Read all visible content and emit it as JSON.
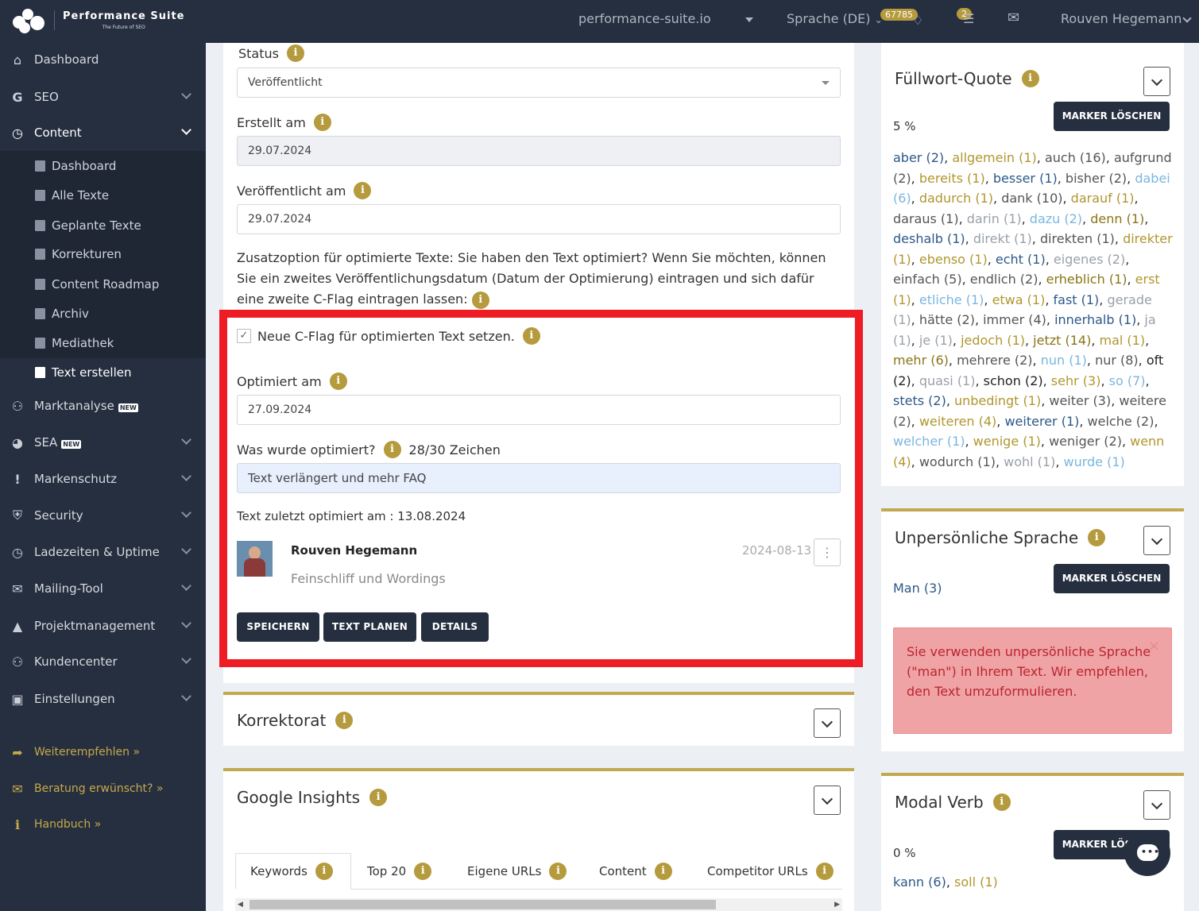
{
  "topbar": {
    "brand_title": "Performance Suite",
    "brand_sub": "The Future of SEO",
    "domain": "performance-suite.io",
    "language": "Sprache (DE)",
    "credits": "67785",
    "notifications": "2",
    "user": "Rouven Hegemann"
  },
  "sidebar": {
    "items": [
      {
        "label": "Dashboard"
      },
      {
        "label": "SEO"
      },
      {
        "label": "Content"
      },
      {
        "label": "Marktanalyse"
      },
      {
        "label": "SEA"
      },
      {
        "label": "Markenschutz"
      },
      {
        "label": "Security"
      },
      {
        "label": "Ladezeiten & Uptime"
      },
      {
        "label": "Mailing-Tool"
      },
      {
        "label": "Projektmanagement"
      },
      {
        "label": "Kundencenter"
      },
      {
        "label": "Einstellungen"
      }
    ],
    "sub_items": [
      {
        "label": "Dashboard"
      },
      {
        "label": "Alle Texte"
      },
      {
        "label": "Geplante Texte"
      },
      {
        "label": "Korrekturen"
      },
      {
        "label": "Content Roadmap"
      },
      {
        "label": "Archiv"
      },
      {
        "label": "Mediathek"
      },
      {
        "label": "Text erstellen"
      }
    ],
    "new_badge": "NEW",
    "links": [
      {
        "label": "Weiterempfehlen »"
      },
      {
        "label": "Beratung erwünscht? »"
      },
      {
        "label": "Handbuch »"
      }
    ]
  },
  "form": {
    "status_label": "Status",
    "status_value": "Veröffentlicht",
    "created_label": "Erstellt am",
    "created_value": "29.07.2024",
    "published_label": "Veröffentlicht am",
    "published_value": "29.07.2024",
    "extra_option": "Zusatzoption für optimierte Texte: Sie haben den Text optimiert? Wenn Sie möchten, können Sie ein zweites Veröffentlichungsdatum (Datum der Optimierung) eintragen und sich dafür eine zweite C-Flag eintragen lassen:",
    "cflag_label": "Neue C-Flag für optimierten Text setzen.",
    "optimized_label": "Optimiert am",
    "optimized_value": "27.09.2024",
    "what_label": "Was wurde optimiert?",
    "char_count": "28/30 Zeichen",
    "what_value": "Text verlängert und mehr FAQ",
    "last_optimized": "Text zuletzt optimiert am : 13.08.2024",
    "comment_author": "Rouven Hegemann",
    "comment_date": "2024-08-13",
    "comment_text": "Feinschliff und Wordings",
    "btn_save": "SPEICHERN",
    "btn_plan": "TEXT PLANEN",
    "btn_details": "DETAILS"
  },
  "panels": {
    "korrektorat": "Korrektorat",
    "insights": "Google Insights",
    "tabs": [
      {
        "label": "Keywords"
      },
      {
        "label": "Top 20"
      },
      {
        "label": "Eigene URLs"
      },
      {
        "label": "Content"
      },
      {
        "label": "Competitor URLs"
      }
    ]
  },
  "fuellwort": {
    "title": "Füllwort-Quote",
    "marker": "MARKER LÖSCHEN",
    "percent": "5 %",
    "words": [
      {
        "t": "aber (2)",
        "c": 0
      },
      {
        "t": "allgemein (1)",
        "c": 1
      },
      {
        "t": "auch (16)",
        "c": 2
      },
      {
        "t": "aufgrund (2)",
        "c": 2
      },
      {
        "t": "bereits (1)",
        "c": 1
      },
      {
        "t": "besser (1)",
        "c": 0
      },
      {
        "t": "bisher (2)",
        "c": 2
      },
      {
        "t": "dabei (6)",
        "c": 3
      },
      {
        "t": "dadurch (1)",
        "c": 1
      },
      {
        "t": "dank (10)",
        "c": 2
      },
      {
        "t": "darauf (1)",
        "c": 1
      },
      {
        "t": "daraus (1)",
        "c": 2
      },
      {
        "t": "darin (1)",
        "c": 4
      },
      {
        "t": "dazu (2)",
        "c": 3
      },
      {
        "t": "denn (1)",
        "c": 5
      },
      {
        "t": "deshalb (1)",
        "c": 0
      },
      {
        "t": "direkt (1)",
        "c": 4
      },
      {
        "t": "direkten (1)",
        "c": 2
      },
      {
        "t": "direkter (1)",
        "c": 1
      },
      {
        "t": "ebenso (1)",
        "c": 1
      },
      {
        "t": "echt (1)",
        "c": 0
      },
      {
        "t": "eigenes (2)",
        "c": 4
      },
      {
        "t": "einfach (5)",
        "c": 2
      },
      {
        "t": "endlich (2)",
        "c": 2
      },
      {
        "t": "erheblich (1)",
        "c": 5
      },
      {
        "t": "erst (1)",
        "c": 1
      },
      {
        "t": "etliche (1)",
        "c": 3
      },
      {
        "t": "etwa (1)",
        "c": 1
      },
      {
        "t": "fast (1)",
        "c": 0
      },
      {
        "t": "gerade (1)",
        "c": 4
      },
      {
        "t": "hätte (2)",
        "c": 2
      },
      {
        "t": "immer (4)",
        "c": 2
      },
      {
        "t": "innerhalb (1)",
        "c": 0
      },
      {
        "t": "ja (1)",
        "c": 4
      },
      {
        "t": "je (1)",
        "c": 4
      },
      {
        "t": "jedoch (1)",
        "c": 1
      },
      {
        "t": "jetzt (14)",
        "c": 5
      },
      {
        "t": "mal (1)",
        "c": 1
      },
      {
        "t": "mehr (6)",
        "c": 5
      },
      {
        "t": "mehrere (2)",
        "c": 2
      },
      {
        "t": "nun (1)",
        "c": 3
      },
      {
        "t": "nur (8)",
        "c": 2
      },
      {
        "t": "oft (2)",
        "c": 6
      },
      {
        "t": "quasi (1)",
        "c": 4
      },
      {
        "t": "schon (2)",
        "c": 6
      },
      {
        "t": "sehr (3)",
        "c": 1
      },
      {
        "t": "so (7)",
        "c": 3
      },
      {
        "t": "stets (2)",
        "c": 0
      },
      {
        "t": "unbedingt (1)",
        "c": 1
      },
      {
        "t": "weiter (3)",
        "c": 2
      },
      {
        "t": "weitere (2)",
        "c": 2
      },
      {
        "t": "weiteren (4)",
        "c": 1
      },
      {
        "t": "weiterer (1)",
        "c": 0
      },
      {
        "t": "welche (2)",
        "c": 2
      },
      {
        "t": "welcher (1)",
        "c": 3
      },
      {
        "t": "wenige (1)",
        "c": 1
      },
      {
        "t": "weniger (2)",
        "c": 2
      },
      {
        "t": "wenn (4)",
        "c": 1
      },
      {
        "t": "wodurch (1)",
        "c": 2
      },
      {
        "t": "wohl (1)",
        "c": 4
      },
      {
        "t": "wurde (1)",
        "c": 3
      }
    ]
  },
  "unpersoenlich": {
    "title": "Unpersönliche Sprache",
    "marker": "MARKER LÖSCHEN",
    "found": "Man (3)",
    "alert": "Sie verwenden unpersönliche Sprache (\"man\") in Ihrem Text. Wir empfehlen, den Text umzuformulieren."
  },
  "modal": {
    "title": "Modal Verb",
    "marker": "MARKER LÖSCHEN",
    "percent": "0 %",
    "words": [
      {
        "t": "kann (6)",
        "c": 0
      },
      {
        "t": "soll (1)",
        "c": 1
      }
    ]
  },
  "colors": {
    "sidebar": "#262f3f",
    "accent": "#b59b3d",
    "highlight": "#ee1c25",
    "alert_bg": "#f0a3a5"
  }
}
